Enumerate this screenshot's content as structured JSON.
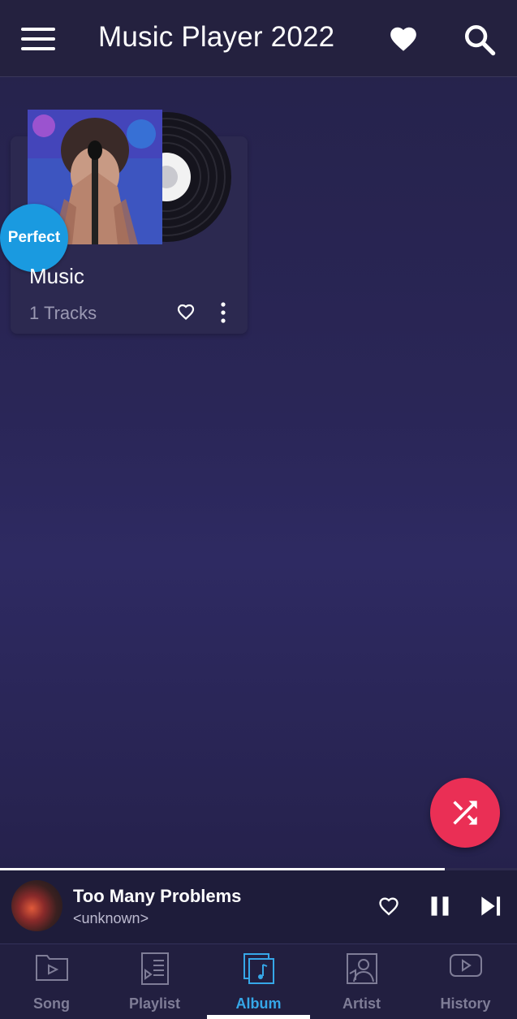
{
  "app": {
    "title": "Music Player 2022",
    "icons": {
      "menu": "hamburger-menu-icon",
      "favorites": "heart-icon",
      "search": "search-icon"
    }
  },
  "album": {
    "badge": "Perfect",
    "name": "Music",
    "tracks": "1 Tracks",
    "icons": {
      "favorite": "heart-outline-icon",
      "more": "more-vertical-icon"
    }
  },
  "fab": {
    "icon": "shuffle-icon",
    "color": "#ea2f55"
  },
  "mini_player": {
    "title": "Too Many Problems",
    "artist": "<unknown>",
    "progress": 0.86,
    "icons": {
      "favorite": "heart-outline-icon",
      "pause": "pause-icon",
      "next": "skip-next-icon"
    }
  },
  "nav": {
    "items": [
      {
        "label": "Song",
        "icon": "song-folder-icon",
        "active": false
      },
      {
        "label": "Playlist",
        "icon": "playlist-icon",
        "active": false
      },
      {
        "label": "Album",
        "icon": "album-icon",
        "active": true
      },
      {
        "label": "Artist",
        "icon": "artist-icon",
        "active": false
      },
      {
        "label": "History",
        "icon": "history-icon",
        "active": false
      }
    ],
    "active_color": "#36a7e8"
  }
}
